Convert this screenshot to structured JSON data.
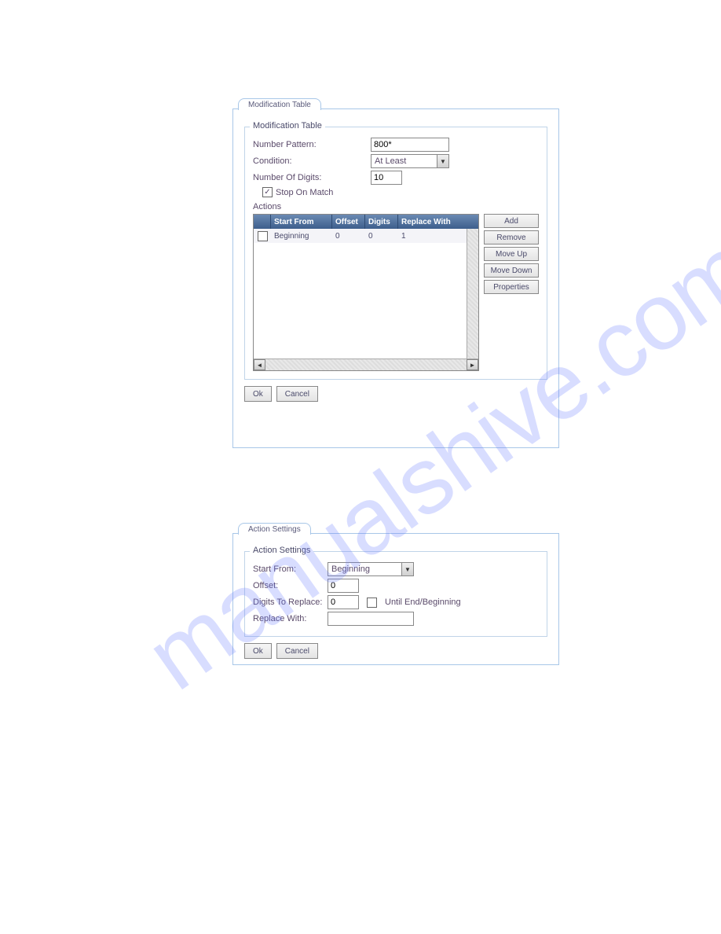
{
  "watermark": "manualshive.com",
  "dialog1": {
    "tab": "Modification Table",
    "legend": "Modification Table",
    "labels": {
      "numberPattern": "Number Pattern:",
      "condition": "Condition:",
      "numDigits": "Number Of Digits:",
      "stopOnMatch": "Stop On Match",
      "actions": "Actions"
    },
    "values": {
      "numberPattern": "800*",
      "condition": "At Least",
      "numDigits": "10",
      "stopOnMatchChecked": "✓"
    },
    "table": {
      "headers": {
        "startFrom": "Start From",
        "offset": "Offset",
        "digits": "Digits",
        "replaceWith": "Replace With"
      },
      "row1": {
        "startFrom": "Beginning",
        "offset": "0",
        "digits": "0",
        "replaceWith": "1"
      }
    },
    "buttons": {
      "add": "Add",
      "remove": "Remove",
      "moveUp": "Move Up",
      "moveDown": "Move Down",
      "properties": "Properties",
      "ok": "Ok",
      "cancel": "Cancel"
    }
  },
  "dialog2": {
    "tab": "Action Settings",
    "legend": "Action Settings",
    "labels": {
      "startFrom": "Start From:",
      "offset": "Offset:",
      "digitsToReplace": "Digits To Replace:",
      "replaceWith": "Replace With:",
      "untilEnd": "Until End/Beginning"
    },
    "values": {
      "startFrom": "Beginning",
      "offset": "0",
      "digitsToReplace": "0",
      "replaceWith": ""
    },
    "buttons": {
      "ok": "Ok",
      "cancel": "Cancel"
    }
  }
}
